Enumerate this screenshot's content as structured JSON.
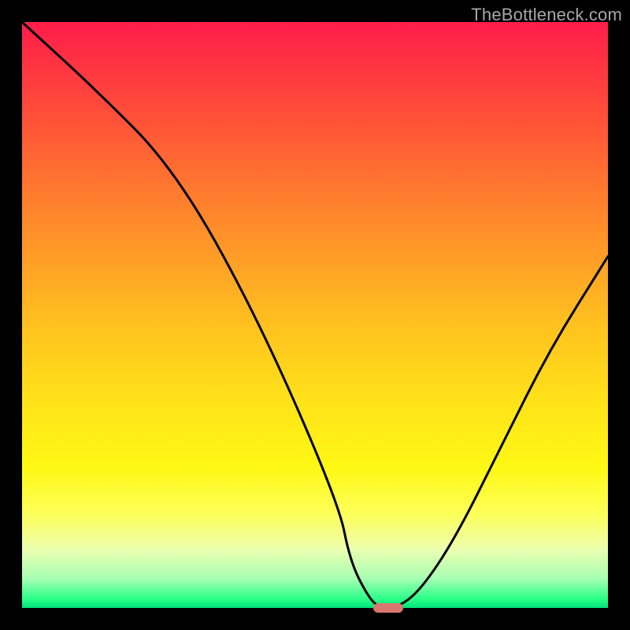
{
  "watermark": "TheBottleneck.com",
  "chart_data": {
    "type": "line",
    "title": "",
    "xlabel": "",
    "ylabel": "",
    "xlim": [
      0,
      100
    ],
    "ylim": [
      0,
      100
    ],
    "grid": false,
    "legend": null,
    "series": [
      {
        "name": "bottleneck-curve",
        "x": [
          0,
          12,
          26,
          40,
          54,
          56,
          59,
          61,
          64,
          68,
          74,
          82,
          90,
          100
        ],
        "y": [
          100,
          89,
          75,
          50,
          18,
          8,
          2,
          0,
          0,
          3,
          12,
          28,
          44,
          60
        ]
      }
    ],
    "annotations": [
      {
        "name": "optimal-marker",
        "shape": "pill",
        "color": "#d9776f",
        "x_start": 60,
        "x_end": 65,
        "y": 0
      }
    ],
    "background_gradient": {
      "stops": [
        {
          "pos": 0.0,
          "color": "#ff1d49"
        },
        {
          "pos": 0.5,
          "color": "#ffc21f"
        },
        {
          "pos": 0.85,
          "color": "#fdff5a"
        },
        {
          "pos": 1.0,
          "color": "#00e27a"
        }
      ]
    }
  }
}
